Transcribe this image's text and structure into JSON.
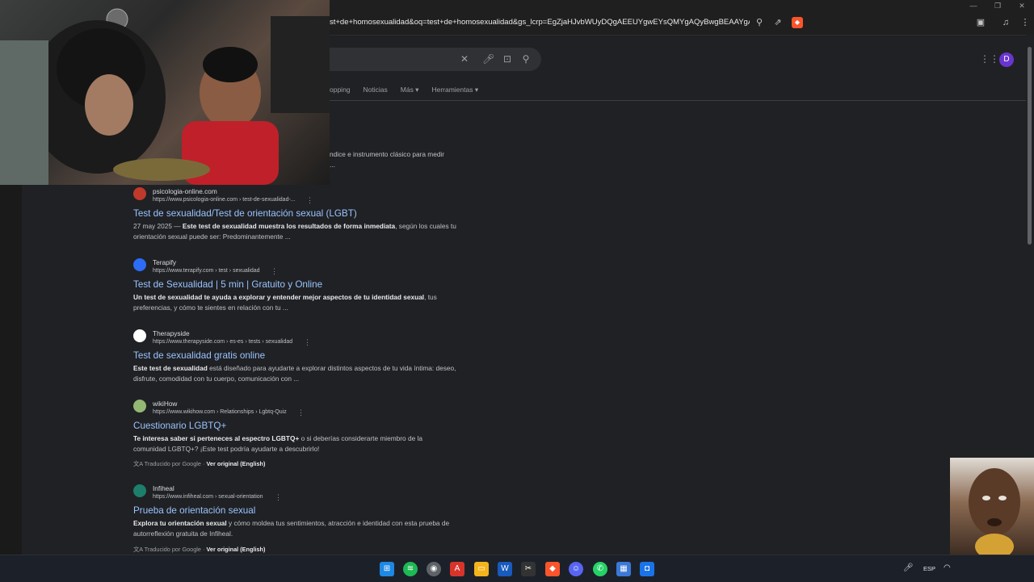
{
  "browser": {
    "url": "st+de+homosexualidad&oq=test+de+homosexualidad&gs_lcrp=EgZjaHJvbWUyDQgAEEUYgwEYsQMYgAQyBwgBEAAYgAQ...",
    "icons": [
      "search-icon",
      "share-icon",
      "brave-shield-icon",
      "reader-icon",
      "media-icon"
    ]
  },
  "search": {
    "tabs": [
      "opping",
      "Noticias",
      "Más ▾",
      "Herramientas ▾"
    ],
    "avatar_letter": "D"
  },
  "partial_snippet": {
    "line1": "ndice e instrumento clásico para medir",
    "line2": "..."
  },
  "results": [
    {
      "site": "psicologia-online.com",
      "cite": "https://www.psicologia-online.com › test-de-sexualidad-...",
      "title": "Test de sexualidad/Test de orientación sexual (LGBT)",
      "date": "27 may 2025 — ",
      "desc_bold": "Este test de sexualidad muestra los resultados de forma inmediata",
      "desc_rest": ", según los cuales tu orientación sexual puede ser: Predominantemente ...",
      "icon_color": "#c0392b"
    },
    {
      "site": "Terapify",
      "cite": "https://www.terapify.com › test › sexualidad",
      "title": "Test de Sexualidad | 5 min | Gratuito y Online",
      "date": "",
      "desc_bold": "Un test de sexualidad te ayuda a explorar y entender mejor aspectos de tu identidad sexual",
      "desc_rest": ", tus preferencias, y cómo te sientes en relación con tu ...",
      "icon_color": "#2c6cf6"
    },
    {
      "site": "Therapyside",
      "cite": "https://www.therapyside.com › es-es › tests › sexualidad",
      "title": "Test de sexualidad gratis online",
      "date": "",
      "desc_bold": "Este test de sexualidad",
      "desc_rest": " está diseñado para ayudarte a explorar distintos aspectos de tu vida íntima: deseo, disfrute, comodidad con tu cuerpo, comunicación con ...",
      "icon_color": "#e74c3c"
    },
    {
      "site": "wikiHow",
      "cite": "https://www.wikihow.com › Relationships › Lgbtq-Quiz",
      "title": "Cuestionario LGBTQ+",
      "date": "",
      "desc_bold": "Te interesa saber si perteneces al espectro LGBTQ+",
      "desc_rest": " o si deberías considerarte miembro de la comunidad LGBTQ+? ¡Este test podría ayudarte a descubrirlo!",
      "icon_color": "#93b874"
    },
    {
      "site": "Infiheal",
      "cite": "https://www.infiheal.com › sexual-orientation",
      "title": "Prueba de orientación sexual",
      "date": "",
      "desc_bold": "Explora tu orientación sexual",
      "desc_rest": " y cómo moldea tus sentimientos, atracción e identidad con esta prueba de autorreflexión gratuita de Infiheal.",
      "icon_color": "#1d7f6b"
    }
  ],
  "translation": {
    "label": "Traducido por Google · ",
    "link": "Ver original (English)"
  },
  "taskbar": {
    "lang": "ESP",
    "apps": [
      "windows-start",
      "spotify",
      "chrome",
      "acrobat",
      "file-explorer",
      "word",
      "capcut",
      "brave",
      "discord",
      "whatsapp",
      "settings",
      "roblox-studio"
    ]
  }
}
